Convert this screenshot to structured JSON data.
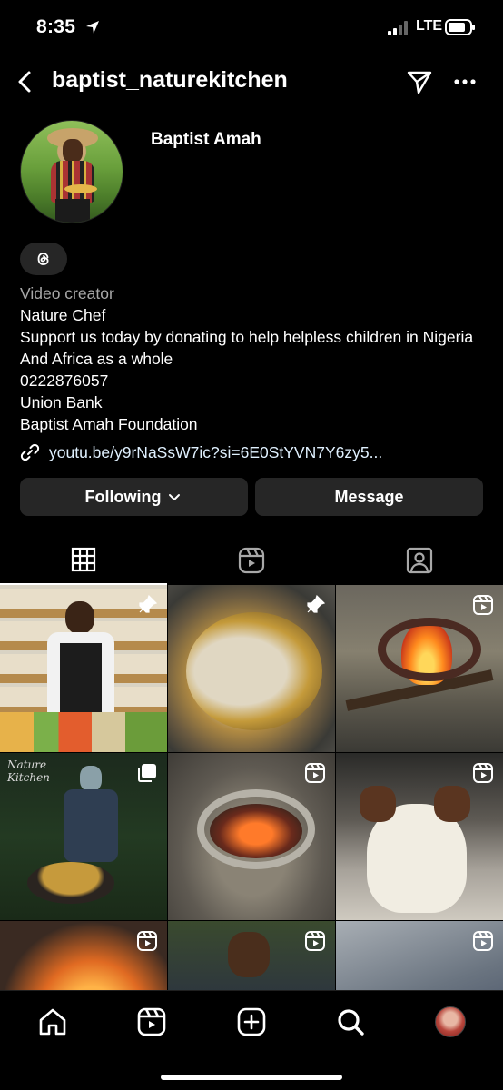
{
  "status": {
    "time": "8:35",
    "network": "LTE"
  },
  "header": {
    "username": "baptist_naturekitchen"
  },
  "profile": {
    "display_name": "Baptist Amah",
    "category": "Video creator",
    "bio_lines": [
      "Nature Chef",
      "Support us today by donating to help helpless children in Nigeria And Africa as a whole",
      "0222876057",
      "Union Bank",
      "Baptist Amah Foundation"
    ],
    "link": "youtu.be/y9rNaSsW7ic?si=6E0StYVN7Y6zy5..."
  },
  "actions": {
    "following_label": "Following",
    "message_label": "Message"
  },
  "tabs": [
    "grid",
    "reels",
    "tagged"
  ],
  "grid": {
    "posts": [
      {
        "overlay": "pin-icon"
      },
      {
        "overlay": "pin-icon"
      },
      {
        "overlay": "reel-icon"
      },
      {
        "overlay": "carousel-icon",
        "watermark": "Nature Kitchen"
      },
      {
        "overlay": "reel-icon"
      },
      {
        "overlay": "reel-icon"
      },
      {
        "overlay": "reel-icon"
      },
      {
        "overlay": "reel-icon"
      },
      {
        "overlay": "reel-icon"
      }
    ]
  },
  "bottom_nav": [
    "home-icon",
    "reels-icon",
    "create-icon",
    "search-icon",
    "profile-avatar"
  ]
}
